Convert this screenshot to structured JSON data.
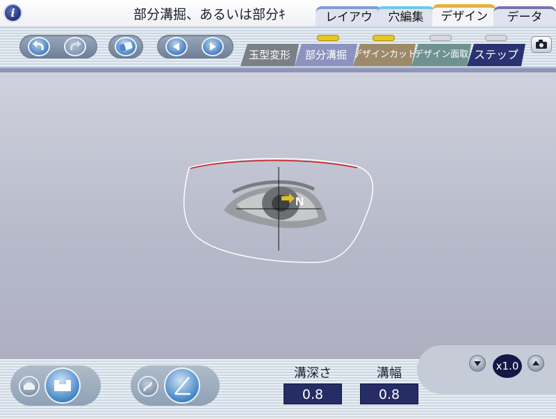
{
  "header": {
    "title": "部分溝掘、あるいは部分ｷ",
    "main_tabs": [
      {
        "label": "レイアウト"
      },
      {
        "label": "穴編集"
      },
      {
        "label": "デザイン",
        "active": true
      },
      {
        "label": "データ"
      }
    ]
  },
  "toolbar": {
    "sub_tabs": [
      {
        "label": "玉型変形"
      },
      {
        "label": "部分溝掘",
        "active": true
      },
      {
        "label": "デザインカット"
      },
      {
        "label": "デザイン面取"
      },
      {
        "label": "ステップ"
      }
    ],
    "indicators": [
      "on",
      "on",
      "off",
      "off"
    ]
  },
  "canvas": {
    "direction_label": "N"
  },
  "params": {
    "groove_depth_label": "溝深さ",
    "groove_depth_value": "0.8",
    "groove_width_label": "溝幅",
    "groove_width_value": "0.8"
  },
  "zoom": {
    "label": "x1.0"
  },
  "colors": {
    "accent_red": "#cc2222",
    "value_box": "#262c64",
    "active_tab_top": "#e6b23a"
  }
}
